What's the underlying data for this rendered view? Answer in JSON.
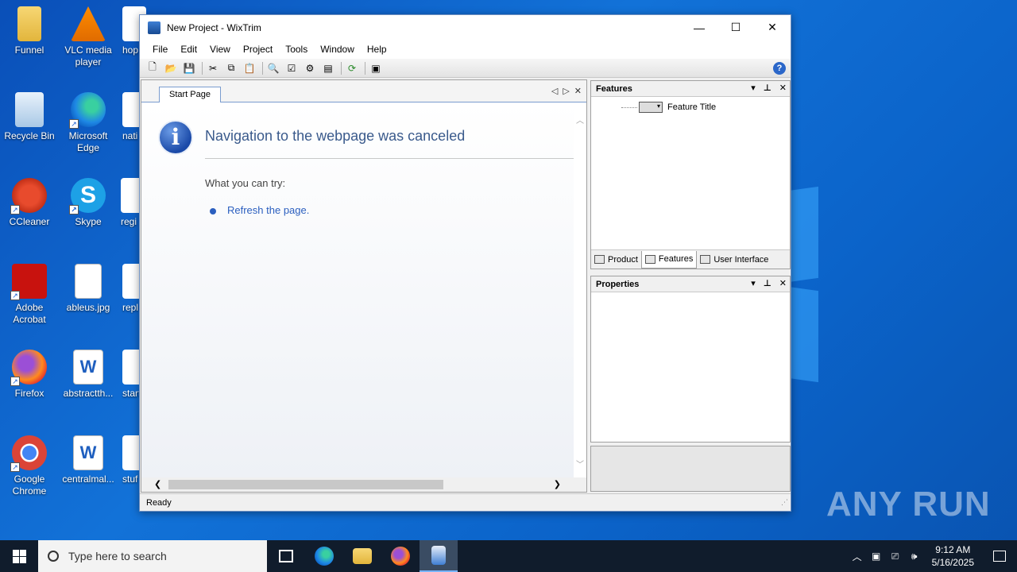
{
  "desktop": {
    "icons": [
      {
        "label": "Funnel"
      },
      {
        "label": "VLC media player"
      },
      {
        "label": "hop"
      },
      {
        "label": "Recycle Bin"
      },
      {
        "label": "Microsoft Edge"
      },
      {
        "label": "nati"
      },
      {
        "label": "CCleaner"
      },
      {
        "label": "Skype"
      },
      {
        "label": "regi"
      },
      {
        "label": "Adobe Acrobat"
      },
      {
        "label": "ableus.jpg"
      },
      {
        "label": "repl"
      },
      {
        "label": "Firefox"
      },
      {
        "label": "abstractth..."
      },
      {
        "label": "start"
      },
      {
        "label": "Google Chrome"
      },
      {
        "label": "centralmal..."
      },
      {
        "label": "stuf"
      }
    ],
    "watermark": "ANY RUN"
  },
  "window": {
    "title": "New Project - WixTrim",
    "controls": {
      "minimize": "—",
      "maximize": "☐",
      "close": "✕"
    },
    "menu": [
      "File",
      "Edit",
      "View",
      "Project",
      "Tools",
      "Window",
      "Help"
    ],
    "toolbar_icons": [
      "new-icon",
      "open-icon",
      "save-icon",
      "cut-icon",
      "copy-icon",
      "paste-icon",
      "find-icon",
      "validate-icon",
      "build-icon",
      "properties-icon",
      "refresh-icon",
      "export-icon",
      "help-icon"
    ]
  },
  "document": {
    "tab_label": "Start Page",
    "heading": "Navigation to the webpage was canceled",
    "try_text": "What you can try:",
    "link_text": "Refresh the page."
  },
  "features_pane": {
    "title": "Features",
    "tree_item": "Feature Title",
    "tabs": [
      {
        "label": "Product"
      },
      {
        "label": "Features"
      },
      {
        "label": "User Interface"
      }
    ],
    "active_tab": "Features"
  },
  "properties_pane": {
    "title": "Properties"
  },
  "status": {
    "text": "Ready"
  },
  "taskbar": {
    "search_placeholder": "Type here to search",
    "time": "9:12 AM",
    "date": "5/16/2025"
  },
  "colors": {
    "desktop_bg": "#1272d8",
    "link": "#2b5fbf",
    "heading": "#3a5a8c",
    "taskbar": "#101c2c"
  }
}
